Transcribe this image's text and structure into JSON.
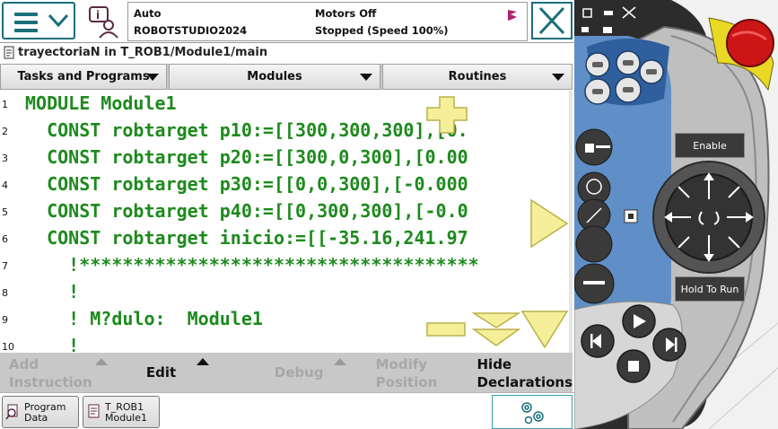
{
  "header": {
    "mode": "Auto",
    "controller": "ROBOTSTUDIO2024",
    "motors": "Motors Off",
    "state": "Stopped (Speed 100%)"
  },
  "breadcrumb": "trayectoriaN  in T_ROB1/Module1/main",
  "tabs": [
    "Tasks and Programs",
    "Modules",
    "Routines"
  ],
  "code_lines": [
    {
      "num": "1",
      "text": "MODULE Module1"
    },
    {
      "num": "2",
      "text": "  CONST robtarget p10:=[[300,300,300],[0."
    },
    {
      "num": "3",
      "text": "  CONST robtarget p20:=[[300,0,300],[0.00"
    },
    {
      "num": "4",
      "text": "  CONST robtarget p30:=[[0,0,300],[-0.000"
    },
    {
      "num": "5",
      "text": "  CONST robtarget p40:=[[0,300,300],[-0.0"
    },
    {
      "num": "6",
      "text": "  CONST robtarget inicio:=[[-35.16,241.97"
    },
    {
      "num": "7",
      "text": "    !*************************************"
    },
    {
      "num": "8",
      "text": "    !"
    },
    {
      "num": "9",
      "text": "    ! M?dulo:  Module1"
    },
    {
      "num": "10",
      "text": "    !"
    }
  ],
  "toolbar": {
    "add_instruction": [
      "Add",
      "Instruction"
    ],
    "edit": "Edit",
    "debug": "Debug",
    "modify_position": [
      "Modify",
      "Position"
    ],
    "hide_declarations": [
      "Hide",
      "Declarations"
    ]
  },
  "taskbar": {
    "program_data": [
      "Program",
      "Data"
    ],
    "t_rob1": [
      "T_ROB1",
      "Module1"
    ]
  },
  "pendant": {
    "enable_label": "Enable",
    "hold_to_run_label": "Hold To Run"
  },
  "colors": {
    "code": "#1d8a1d",
    "accent": "#1a6f79",
    "yellow": "#f5ef9a",
    "pendant_blue": "#5f8fc6"
  }
}
